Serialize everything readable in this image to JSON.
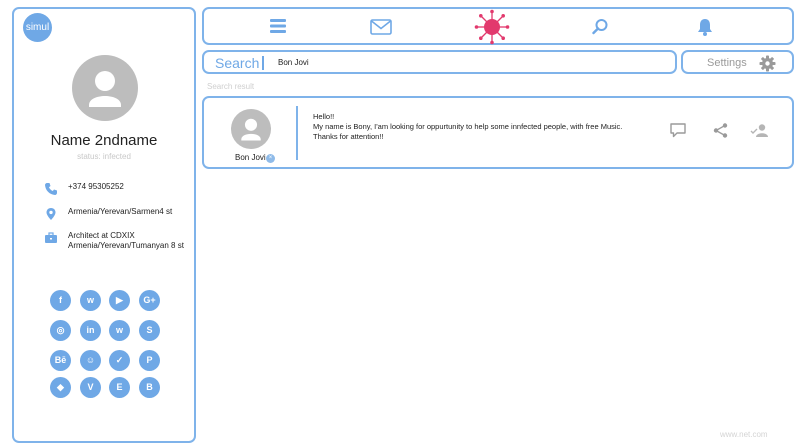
{
  "app": {
    "logo_text": "simul"
  },
  "profile": {
    "name": "Name 2ndname",
    "status": "status: infected",
    "phone": "+374 95305252",
    "address": "Armenia/Yerevan/Sarmen4 st",
    "work_line1": "Architect at CDXIX",
    "work_line2": "Armenia/Yerevan/Tumanyan 8 st",
    "socials": [
      {
        "label": "f",
        "icon": "facebook-icon"
      },
      {
        "label": "w",
        "icon": "whatsapp-icon"
      },
      {
        "label": "▶",
        "icon": "youtube-icon"
      },
      {
        "label": "G+",
        "icon": "google-plus-icon"
      },
      {
        "label": "◎",
        "icon": "instagram-icon"
      },
      {
        "label": "in",
        "icon": "linkedin-icon"
      },
      {
        "label": "w",
        "icon": "whatsapp-icon"
      },
      {
        "label": "S",
        "icon": "skype-icon"
      },
      {
        "label": "Bē",
        "icon": "behance-icon"
      },
      {
        "label": "☺",
        "icon": "snapchat-icon"
      },
      {
        "label": "✓",
        "icon": "twitter-icon"
      },
      {
        "label": "P",
        "icon": "pinterest-icon"
      },
      {
        "label": "◆",
        "icon": "dropbox-icon"
      },
      {
        "label": "V",
        "icon": "vimeo-icon"
      },
      {
        "label": "E",
        "icon": "evernote-icon"
      },
      {
        "label": "B",
        "icon": "blogger-icon"
      }
    ]
  },
  "topnav": {
    "icons": [
      "menu-icon",
      "mail-icon",
      "virus-icon",
      "search-icon",
      "bell-icon"
    ]
  },
  "search": {
    "label": "Search",
    "value": "Bon Jovi"
  },
  "settings": {
    "label": "Settings"
  },
  "results": {
    "label": "Search result",
    "items": [
      {
        "name": "Bon Jovi",
        "message_line1": "Hello!!",
        "message_line2": "My name is Bony, I'am looking for oppurtunity to help some innfected people, with free Music.",
        "message_line3": "Thanks for attention!!"
      }
    ]
  },
  "watermark": "www.net.com",
  "colors": {
    "accent": "#7fb3ea",
    "virus": "#e2396d",
    "avatar": "#bdbdbd",
    "icon_gray": "#9a9a9a"
  }
}
